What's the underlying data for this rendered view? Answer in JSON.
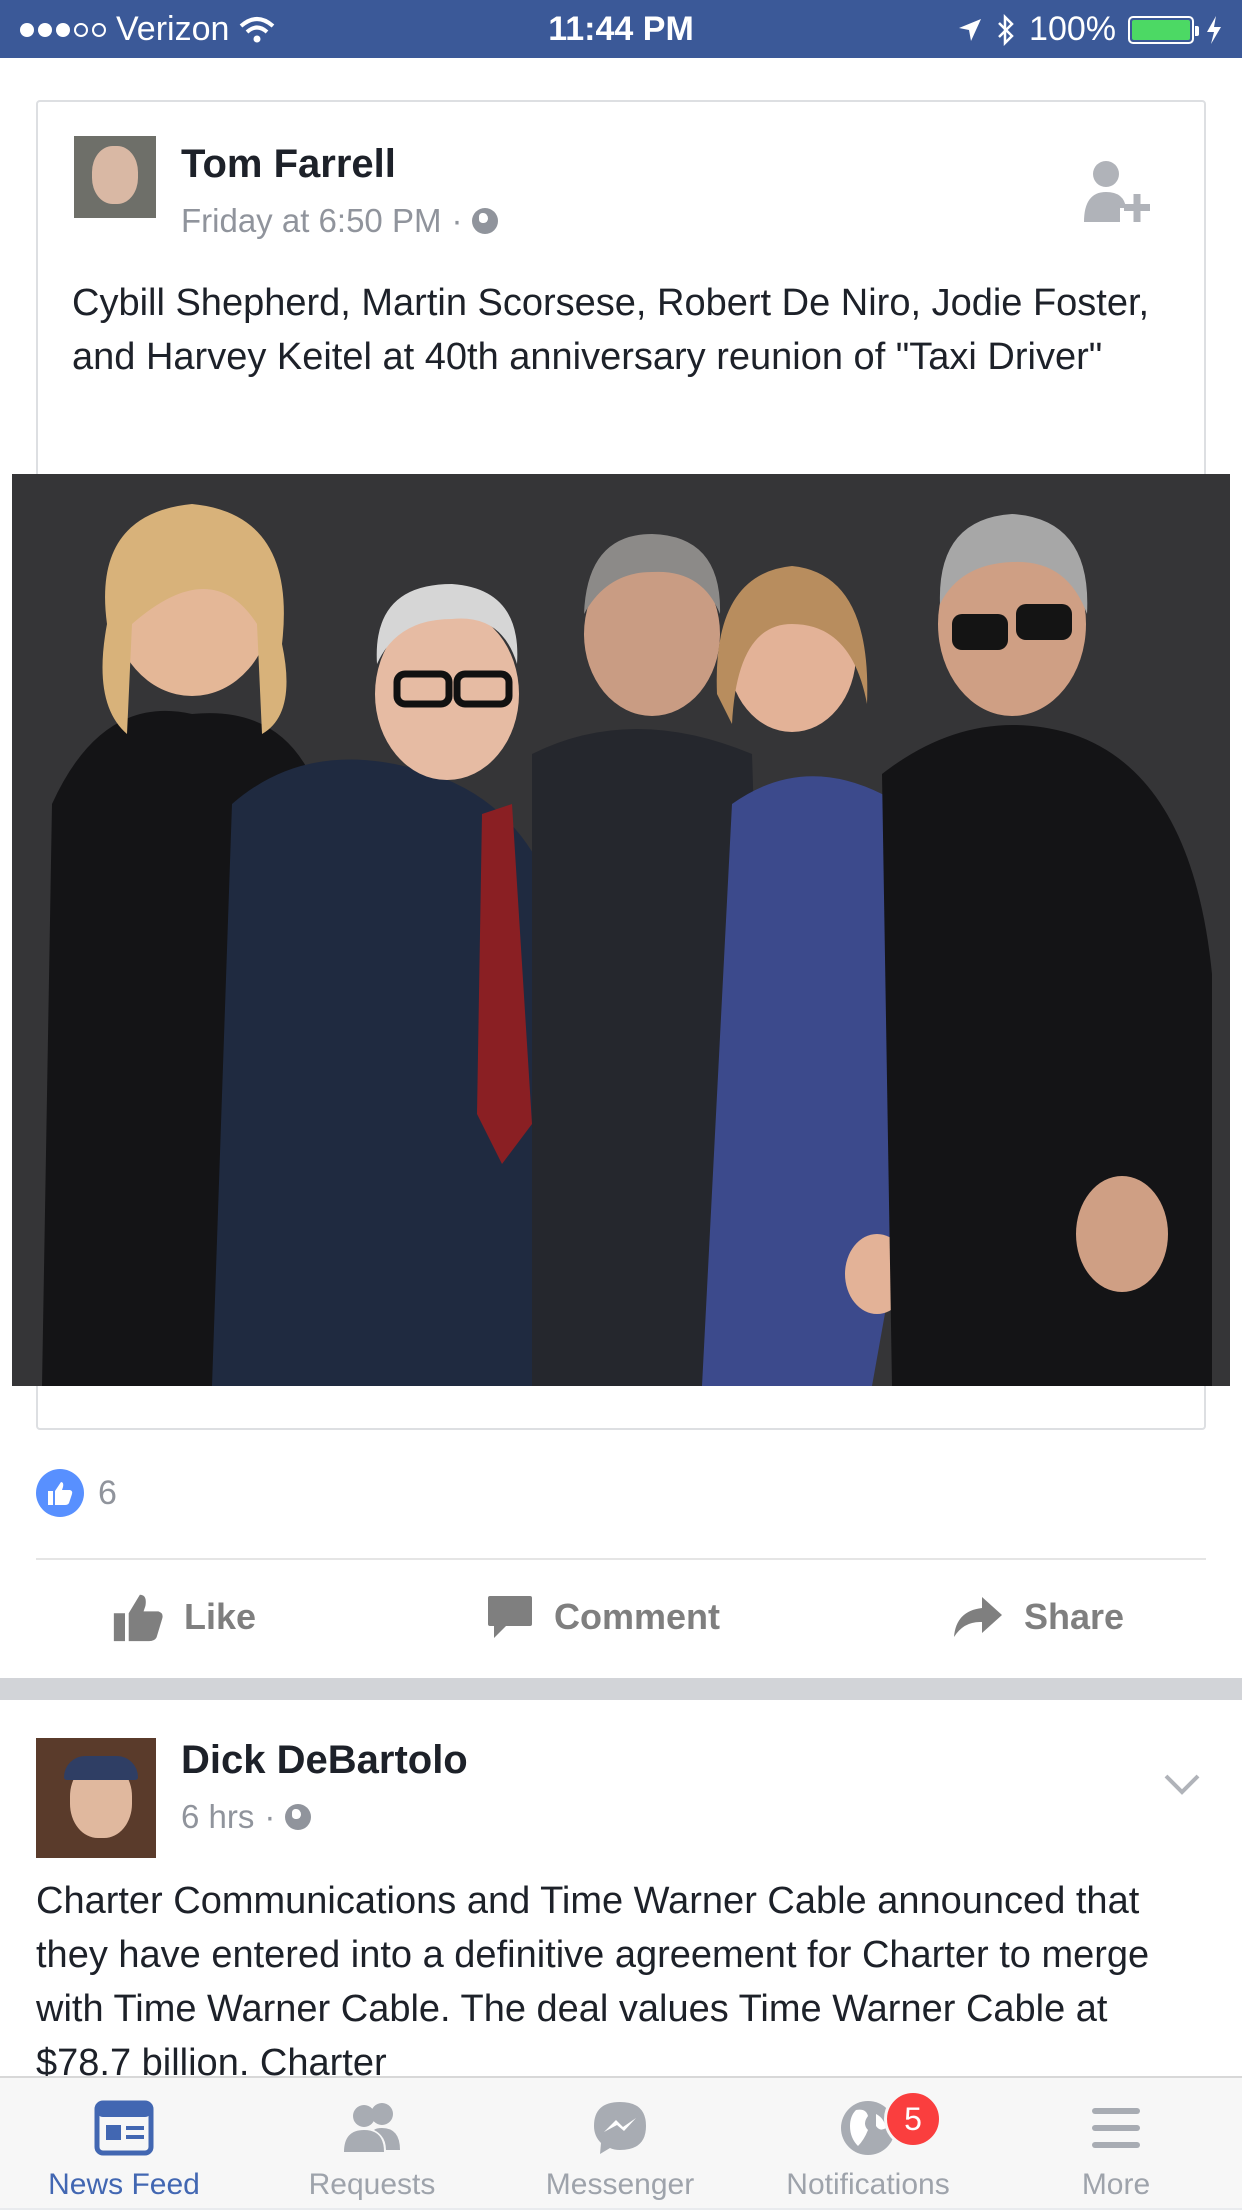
{
  "status_bar": {
    "carrier": "Verizon",
    "time": "11:44 PM",
    "battery": "100%",
    "battery_level": 1.0
  },
  "posts": [
    {
      "author": "Tom Farrell",
      "timestamp": "Friday at 6:50 PM",
      "text": "Cybill Shepherd, Martin Scorsese, Robert De Niro, Jodie Foster, and Harvey Keitel at 40th anniversary reunion of \"Taxi Driver\"",
      "like_count": "6",
      "actions": {
        "like": "Like",
        "comment": "Comment",
        "share": "Share"
      }
    },
    {
      "author": "Dick DeBartolo",
      "timestamp": "6 hrs",
      "text": "Charter Communications and Time Warner Cable announced that they have entered into a definitive agreement for Charter to merge with Time Warner Cable. The deal values Time Warner Cable at $78.7 billion. Charter"
    }
  ],
  "colors": {
    "brand": "#3b5998",
    "active_tab": "#4267b2",
    "like_blue": "#5890ff",
    "badge_red": "#fa3e3e"
  },
  "tab_bar": {
    "tabs": [
      {
        "label": "News Feed",
        "icon": "news-feed-icon",
        "active": true
      },
      {
        "label": "Requests",
        "icon": "friends-icon"
      },
      {
        "label": "Messenger",
        "icon": "messenger-icon"
      },
      {
        "label": "Notifications",
        "icon": "globe-icon",
        "badge": "5"
      },
      {
        "label": "More",
        "icon": "menu-icon"
      }
    ]
  }
}
